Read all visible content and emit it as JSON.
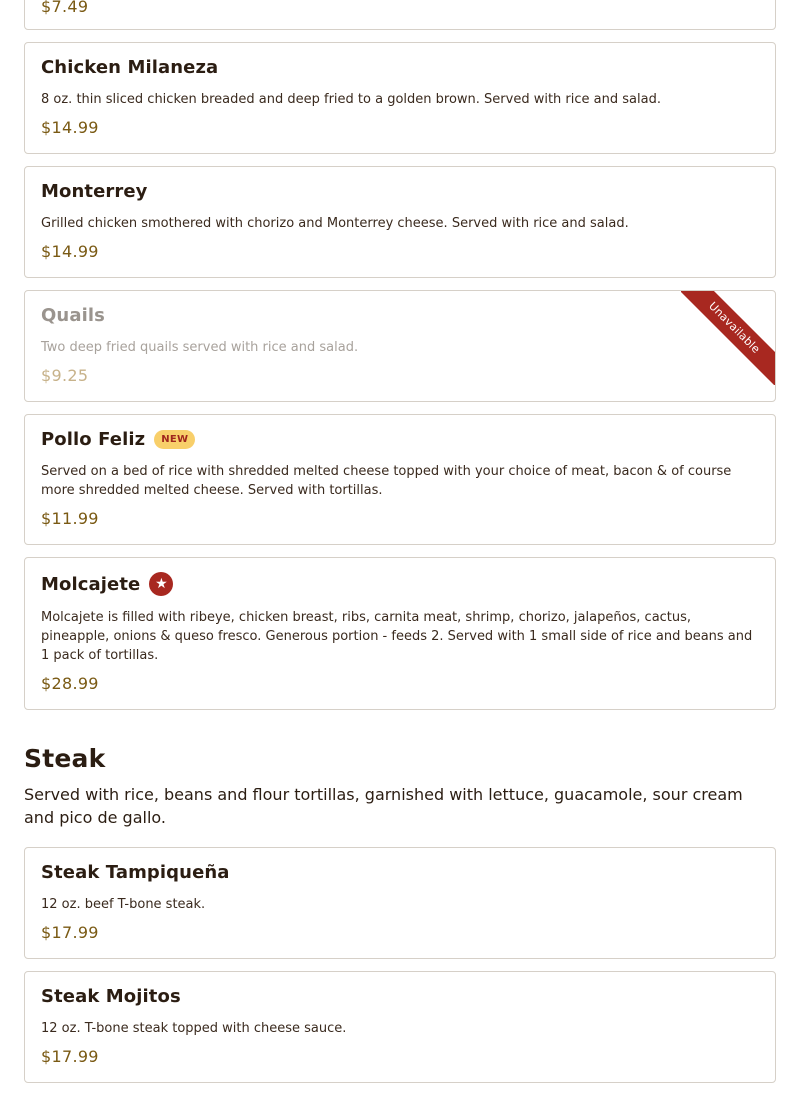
{
  "items_top": [
    {
      "name": "",
      "description": "",
      "price": "$7.49",
      "unavailable": false
    },
    {
      "name": "Chicken Milaneza",
      "description": "8 oz. thin sliced chicken breaded and deep fried to a golden brown. Served with rice and salad.",
      "price": "$14.99"
    },
    {
      "name": "Monterrey",
      "description": "Grilled chicken smothered with chorizo and Monterrey cheese. Served with rice and salad.",
      "price": "$14.99"
    },
    {
      "name": "Quails",
      "description": "Two deep fried quails served with rice and salad.",
      "price": "$9.25",
      "ribbon": "Unavailable"
    },
    {
      "name": "Pollo Feliz",
      "badge": "NEW",
      "description": "Served on a bed of rice with shredded melted cheese topped with your choice of meat, bacon & of course more shredded melted cheese. Served with tortillas.",
      "price": "$11.99"
    },
    {
      "name": "Molcajete",
      "badge_icon": "star-icon",
      "description": "Molcajete is filled with ribeye, chicken breast, ribs, carnita meat, shrimp, chorizo, jalapeños, cactus, pineapple, onions & queso fresco. Generous portion - feeds 2. Served with 1 small side of rice and beans and 1 pack of tortillas.",
      "price": "$28.99"
    }
  ],
  "steak_section": {
    "title": "Steak",
    "description": "Served with rice, beans and flour tortillas, garnished with lettuce, guacamole, sour cream and pico de gallo.",
    "items": [
      {
        "name": "Steak Tampiqueña",
        "description": "12 oz. beef T-bone steak.",
        "price": "$17.99"
      },
      {
        "name": "Steak Mojitos",
        "description": "12 oz. T-bone steak topped with cheese sauce.",
        "price": "$17.99"
      }
    ]
  },
  "colors": {
    "accent_red": "#a82820",
    "price_gold": "#7a5a14",
    "badge_yellow": "#f8cf6a",
    "text_dark": "#2b1d12"
  }
}
